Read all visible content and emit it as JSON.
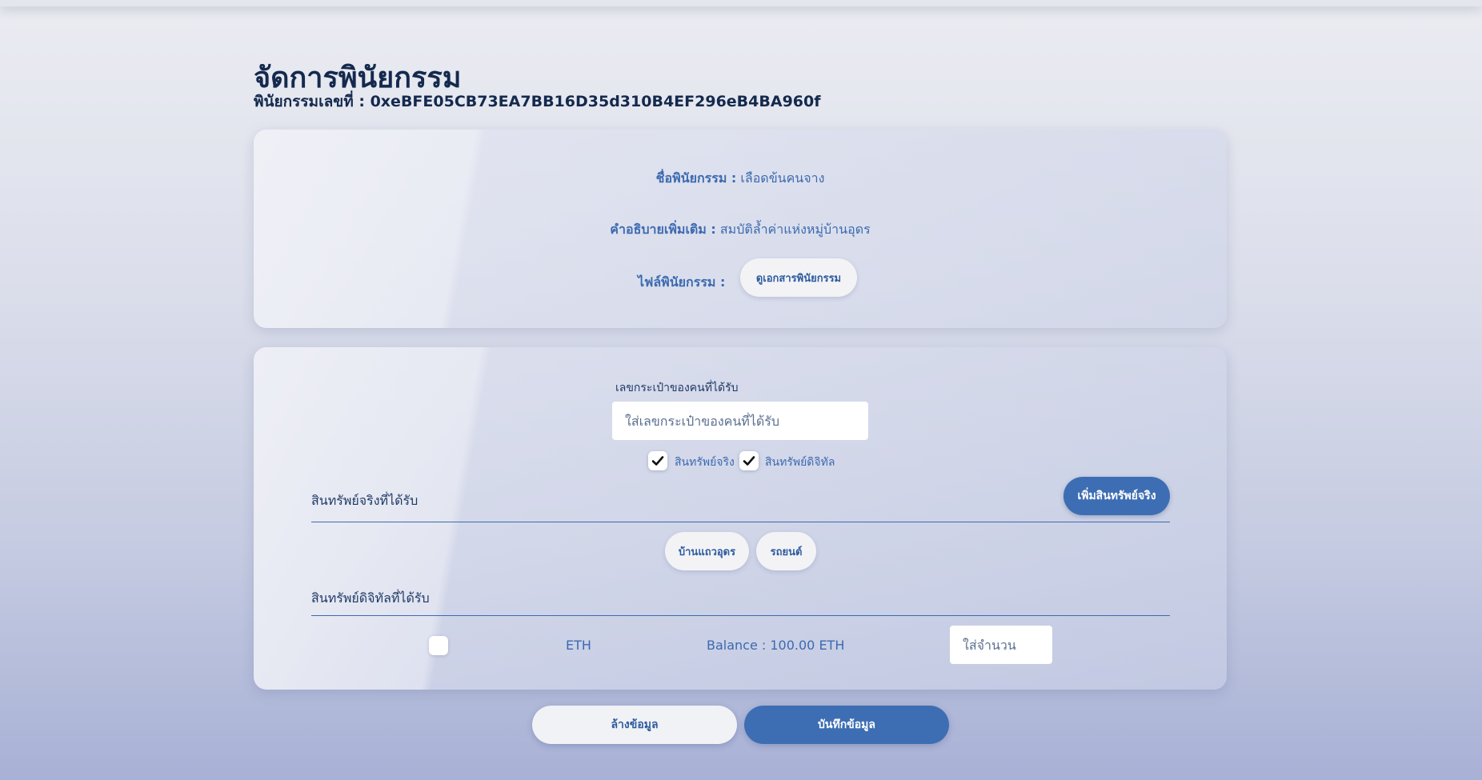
{
  "header": {
    "title": "จัดการพินัยกรรม",
    "tx_label": "พินัยกรรมเลขที่ :",
    "tx_id": "0xeBFE05CB73EA7BB16D35d310B4EF296eB4BA960f"
  },
  "will_info": {
    "name_label": "ชื่อพินัยกรรม :",
    "name_value": "เลือดข้นคนจาง",
    "desc_label": "คำอธิบายเพิ่มเติม :",
    "desc_value": "สมบัติล้ำค่าแห่งหมู่บ้านอุดร",
    "file_label": "ไฟล์พินัยกรรม :",
    "view_doc_button": "ดูเอกสารพินัยกรรม"
  },
  "form": {
    "wallet_label": "เลขกระเป๋าของคนที่ได้รับ",
    "wallet_placeholder": "ใส่เลขกระเป๋าของคนที่ได้รับ",
    "asset_types": [
      {
        "label": "สินทรัพย์จริง",
        "checked": true
      },
      {
        "label": "สินทรัพย์ดิจิทัล",
        "checked": true
      }
    ],
    "real_assets_title": "สินทรัพย์จริงที่ได้รับ",
    "add_real_asset_button": "เพิ่มสินทรัพย์จริง",
    "real_assets": [
      "บ้านแถวอุดร",
      "รถยนต์"
    ],
    "digital_assets_title": "สินทรัพย์ดิจิทัลที่ได้รับ",
    "digital_asset": {
      "symbol": "ETH",
      "balance_text": "Balance : 100.00 ETH",
      "amount_placeholder": "ใส่จำนวน",
      "checked": false
    }
  },
  "actions": {
    "clear_button": "ล้างข้อมูล",
    "save_button": "บันทึกข้อมูล"
  },
  "colors": {
    "accent": "#3d6eb3",
    "title": "#14294d",
    "text": "#3c6ab0"
  }
}
